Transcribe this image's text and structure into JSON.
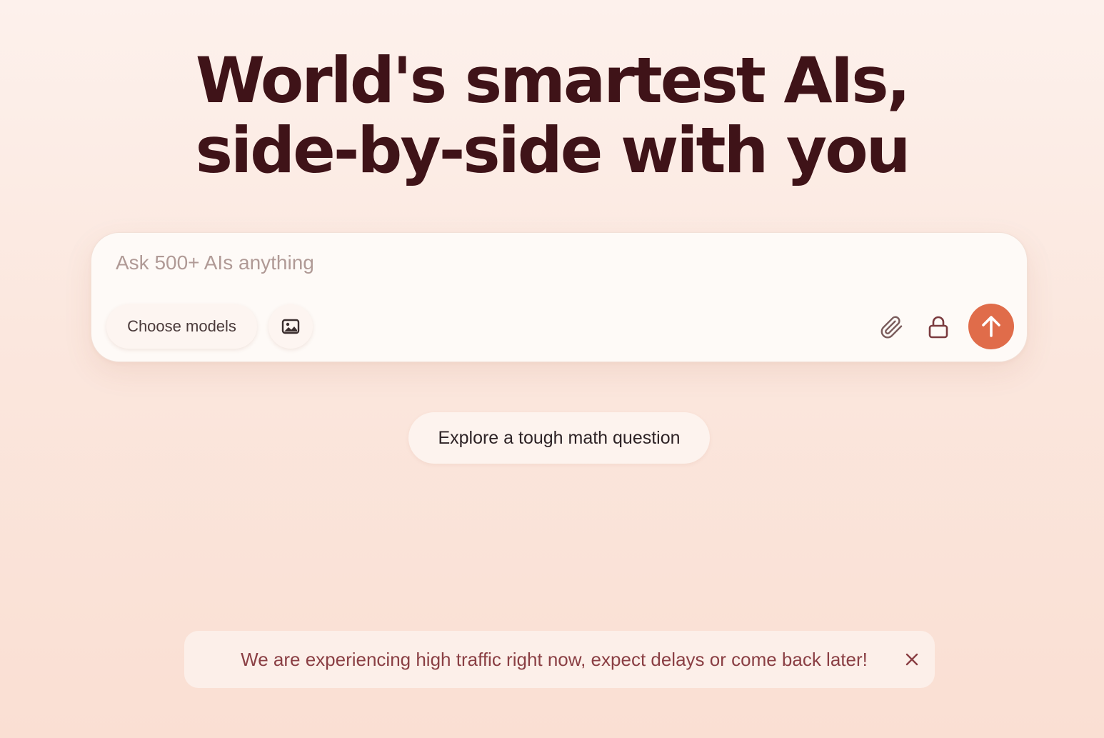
{
  "hero": {
    "line1": "World's smartest AIs,",
    "line2": "side-by-side with you"
  },
  "composer": {
    "placeholder": "Ask 500+ AIs anything",
    "value": "",
    "choose_models_label": "Choose models",
    "icons": {
      "image": "image-icon",
      "attach": "paperclip-icon",
      "private": "lock-icon",
      "send": "arrow-up-icon"
    }
  },
  "suggestions": [
    {
      "label": "Explore a tough math question"
    }
  ],
  "banner": {
    "message": "We are experiencing high traffic right now, expect delays or come back later!",
    "close_icon": "close-icon"
  },
  "colors": {
    "heading": "#3f1318",
    "accent": "#e06c4a",
    "banner_text": "#8a3f44",
    "background_top": "#fdf1ec",
    "background_bottom": "#fadfd3"
  }
}
